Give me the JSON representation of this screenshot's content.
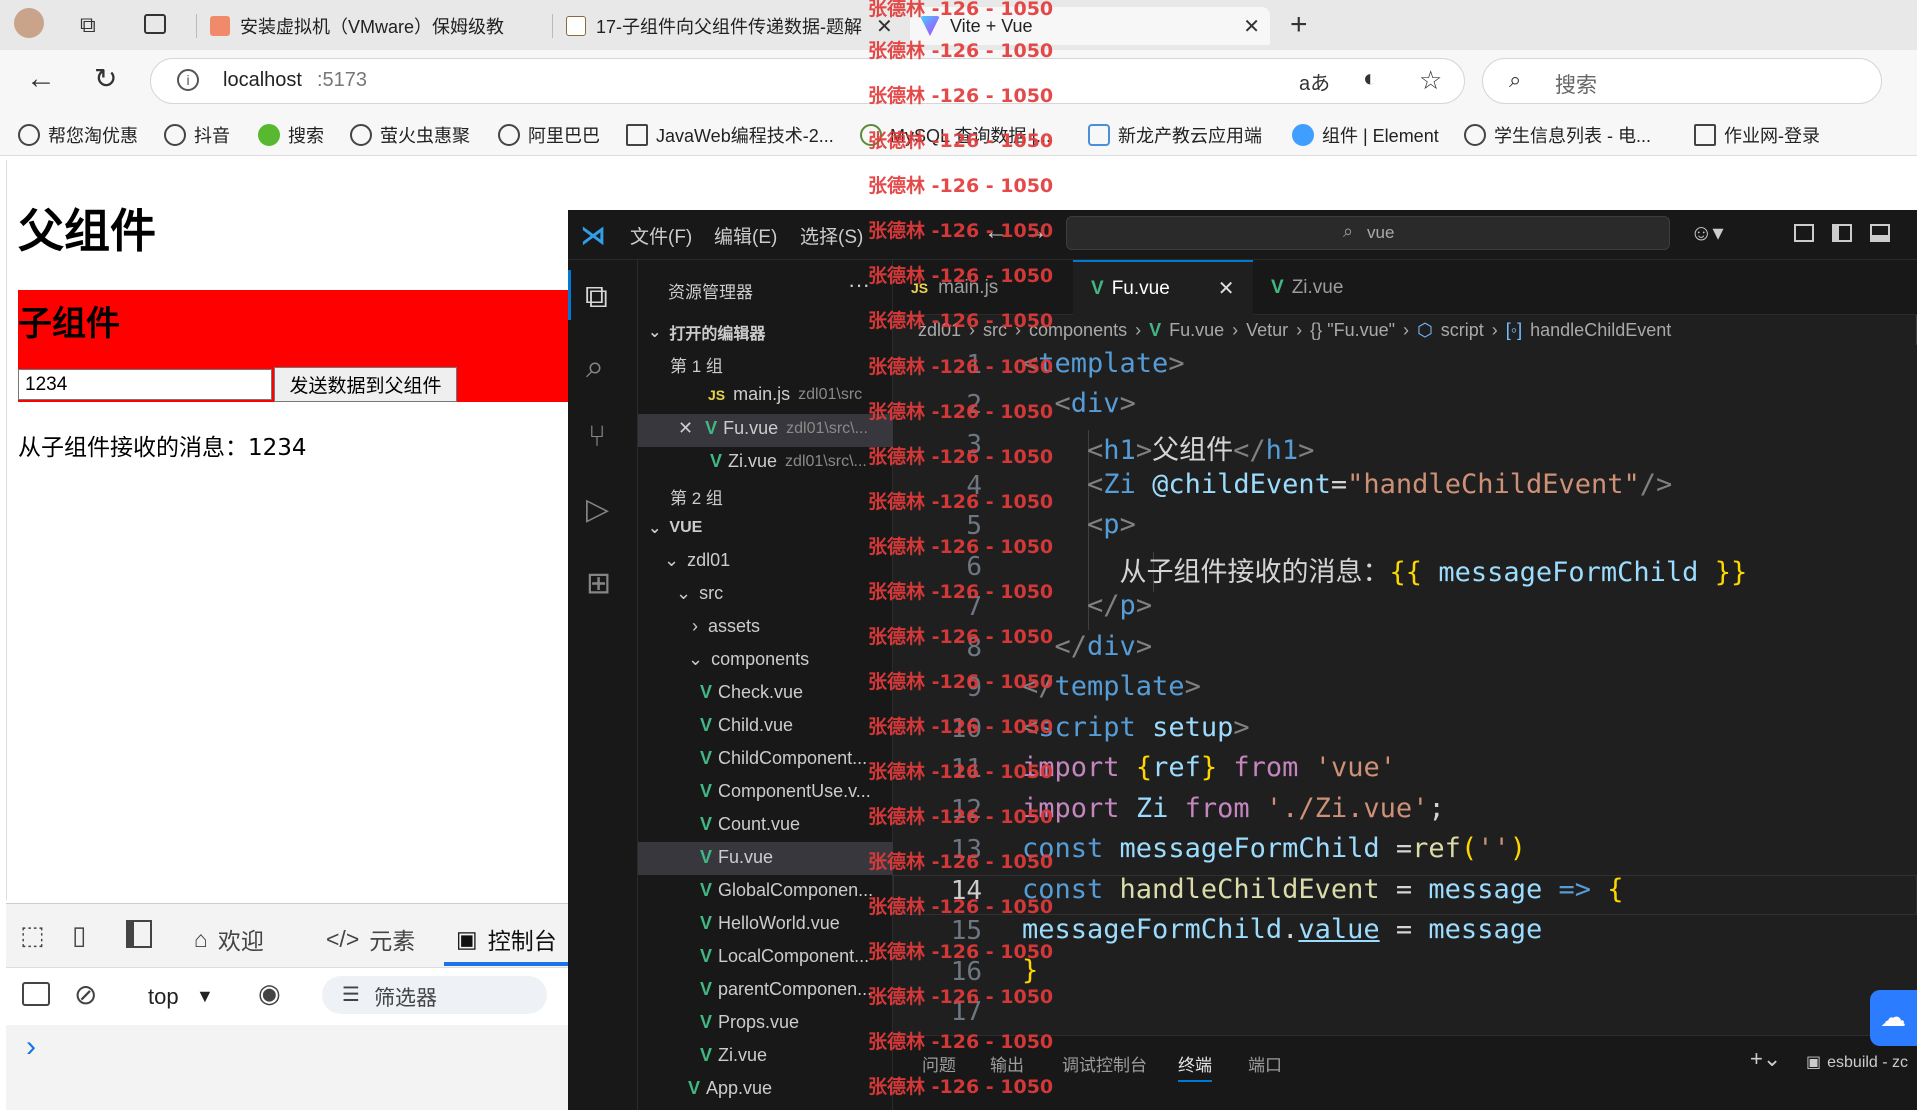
{
  "browser": {
    "tabs": [
      {
        "label": "安装虚拟机（VMware）保姆级教",
        "color": "#f08a6a"
      },
      {
        "label": "17-子组件向父组件传递数据-题解",
        "color": "#8a6a3a"
      },
      {
        "label": "Vite + Vue",
        "color": "#7f5af0"
      }
    ],
    "new_tab": "+",
    "address": {
      "host": "localhost",
      "port": ":5173"
    },
    "search_placeholder": "搜索",
    "bookmarks": [
      "帮您淘优惠",
      "抖音",
      "搜索",
      "萤火虫惠聚",
      "阿里巴巴",
      "JavaWeb编程技术-2...",
      "MySQL 查询数据 |...",
      "新龙产教云应用端",
      "组件 | Element",
      "学生信息列表 - 电...",
      "作业网-登录"
    ]
  },
  "page": {
    "heading": "父组件",
    "child_heading": "子组件",
    "input_value": "1234",
    "send_button": "发送数据到父组件",
    "message": "从子组件接收的消息：1234",
    "child_bg": "#ff0000"
  },
  "devtools": {
    "tabs": [
      "欢迎",
      "元素",
      "控制台"
    ],
    "context": "top",
    "filter": "筛选器",
    "prompt": "›"
  },
  "vscode": {
    "menu": [
      "文件(F)",
      "编辑(E)",
      "选择(S)"
    ],
    "command_center": "vue",
    "explorer_title": "资源管理器",
    "open_editors": "打开的编辑器",
    "group1": "第 1 组",
    "group2": "第 2 组",
    "open_files": [
      {
        "name": "main.js",
        "path": "zdl01\\src"
      },
      {
        "name": "Fu.vue",
        "path": "zdl01\\src\\..."
      },
      {
        "name": "Zi.vue",
        "path": "zdl01\\src\\..."
      }
    ],
    "root": "VUE",
    "project": "zdl01",
    "src": "src",
    "assets": "assets",
    "components": "components",
    "component_files": [
      "Check.vue",
      "Child.vue",
      "ChildComponent...",
      "ComponentUse.v...",
      "Count.vue",
      "Fu.vue",
      "GlobalComponen...",
      "HelloWorld.vue",
      "LocalComponent...",
      "parentComponen...",
      "Props.vue",
      "Zi.vue"
    ],
    "app_file": "App.vue",
    "editor_tabs": [
      "main.js",
      "Fu.vue",
      "Zi.vue"
    ],
    "breadcrumb": [
      "zdl01",
      "src",
      "components",
      "Fu.vue",
      "Vetur",
      "{} \"Fu.vue\"",
      "script",
      "handleChildEvent"
    ],
    "line_numbers": [
      "1",
      "2",
      "3",
      "4",
      "5",
      "6",
      "7",
      "8",
      "9",
      "10",
      "11",
      "12",
      "13",
      "14",
      "15",
      "16",
      "17"
    ],
    "code": {
      "l6_text": "从子组件接收的消息：",
      "l6_expr": "messageFormChild"
    },
    "panel_tabs": [
      "问题",
      "输出",
      "调试控制台",
      "终端",
      "端口"
    ],
    "terminal_name": "esbuild - zc"
  },
  "watermark": "张德林 -126 - 1050"
}
